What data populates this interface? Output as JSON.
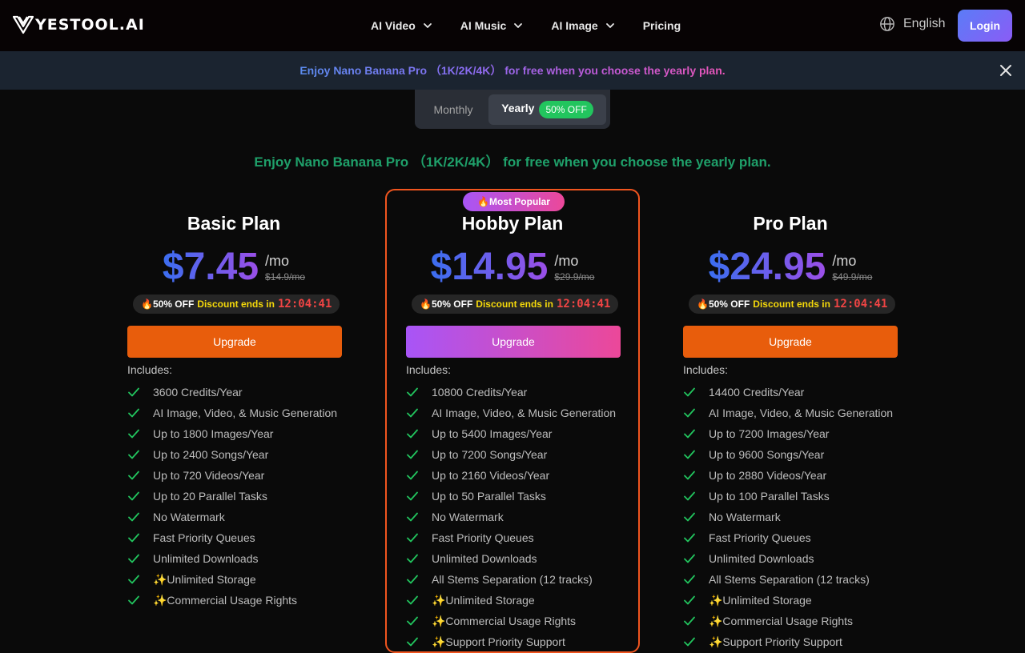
{
  "header": {
    "logo_text": "YESTOOL.AI",
    "nav": [
      {
        "label": "AI Video",
        "dropdown": true
      },
      {
        "label": "AI Music",
        "dropdown": true
      },
      {
        "label": "AI Image",
        "dropdown": true
      },
      {
        "label": "Pricing",
        "dropdown": false
      }
    ],
    "language": "English",
    "login_label": "Login"
  },
  "promo": {
    "text": "Enjoy Nano Banana Pro （1K/2K/4K） for free when you choose the yearly plan."
  },
  "billing": {
    "monthly_label": "Monthly",
    "yearly_label": "Yearly",
    "yearly_badge": "50% OFF",
    "selected": "Yearly"
  },
  "subline": "Enjoy Nano Banana Pro （1K/2K/4K） for free when you choose the yearly plan.",
  "plans": [
    {
      "title": "Basic Plan",
      "price": "$7.45",
      "per": "/mo",
      "old_price": "$14.9/mo",
      "discount_pct": "🔥50% OFF",
      "discount_text": "Discount ends in",
      "timer": "12:04:41",
      "upgrade_label": "Upgrade",
      "includes_label": "Includes:",
      "features": [
        "3600 Credits/Year",
        "AI Image, Video, & Music Generation",
        "Up to 1800 Images/Year",
        "Up to 2400 Songs/Year",
        "Up to 720 Videos/Year",
        "Up to 20 Parallel Tasks",
        "No Watermark",
        "Fast Priority Queues",
        "Unlimited Downloads",
        "✨Unlimited Storage",
        "✨Commercial Usage Rights"
      ]
    },
    {
      "title": "Hobby Plan",
      "badge": "🔥Most Popular",
      "price": "$14.95",
      "per": "/mo",
      "old_price": "$29.9/mo",
      "discount_pct": "🔥50% OFF",
      "discount_text": "Discount ends in",
      "timer": "12:04:41",
      "upgrade_label": "Upgrade",
      "includes_label": "Includes:",
      "features": [
        "10800 Credits/Year",
        "AI Image, Video, & Music Generation",
        "Up to 5400 Images/Year",
        "Up to 7200 Songs/Year",
        "Up to 2160 Videos/Year",
        "Up to 50 Parallel Tasks",
        "No Watermark",
        "Fast Priority Queues",
        "Unlimited Downloads",
        "All Stems Separation (12 tracks)",
        "✨Unlimited Storage",
        "✨Commercial Usage Rights",
        "✨Support Priority Support"
      ]
    },
    {
      "title": "Pro Plan",
      "price": "$24.95",
      "per": "/mo",
      "old_price": "$49.9/mo",
      "discount_pct": "🔥50% OFF",
      "discount_text": "Discount ends in",
      "timer": "12:04:41",
      "upgrade_label": "Upgrade",
      "includes_label": "Includes:",
      "features": [
        "14400 Credits/Year",
        "AI Image, Video, & Music Generation",
        "Up to 7200 Images/Year",
        "Up to 9600 Songs/Year",
        "Up to 2880 Videos/Year",
        "Up to 100 Parallel Tasks",
        "No Watermark",
        "Fast Priority Queues",
        "Unlimited Downloads",
        "All Stems Separation (12 tracks)",
        "✨Unlimited Storage",
        "✨Commercial Usage Rights",
        "✨Support Priority Support"
      ]
    }
  ],
  "colors": {
    "accent_orange": "#e85d0c",
    "check_green": "#22c55e",
    "subline_green": "#1fa06a",
    "timer_red": "#ef4444",
    "discount_yellow": "#f5d90a"
  }
}
